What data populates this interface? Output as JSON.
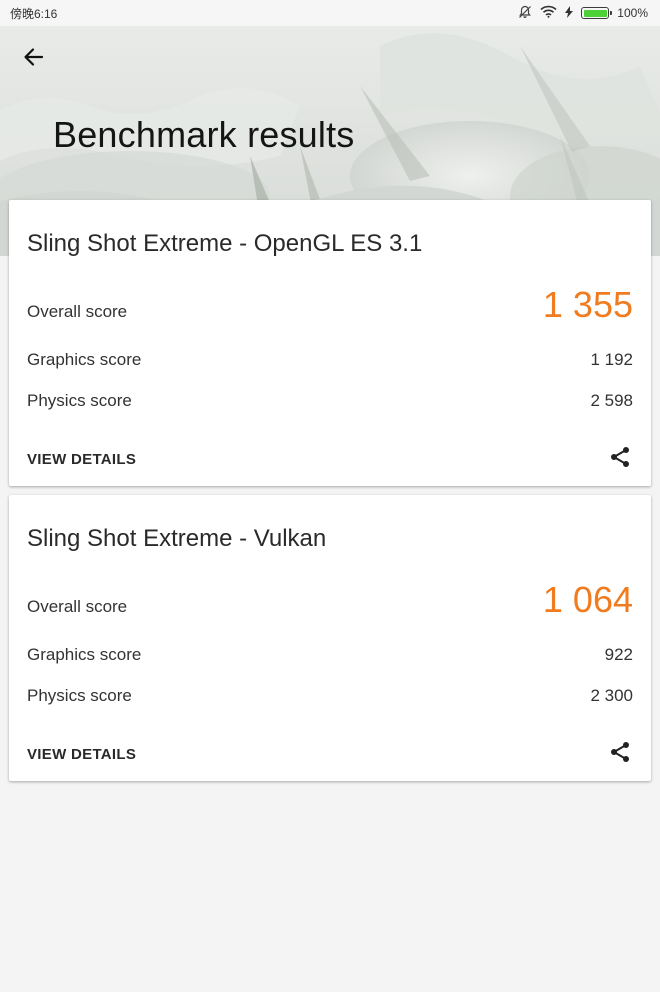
{
  "status_bar": {
    "time": "傍晚6:16",
    "battery": "100%",
    "icons": [
      "notifications-off-icon",
      "wifi-icon",
      "charging-icon",
      "battery-icon"
    ]
  },
  "header": {
    "back_icon": "arrow-back-icon",
    "title": "Benchmark results"
  },
  "results": [
    {
      "title": "Sling Shot Extreme - OpenGL ES 3.1",
      "overall_label": "Overall score",
      "overall_value": "1 355",
      "graphics_label": "Graphics score",
      "graphics_value": "1 192",
      "physics_label": "Physics score",
      "physics_value": "2 598",
      "details_label": "VIEW DETAILS",
      "share_icon": "share-icon"
    },
    {
      "title": "Sling Shot Extreme - Vulkan",
      "overall_label": "Overall score",
      "overall_value": "1 064",
      "graphics_label": "Graphics score",
      "graphics_value": "922",
      "physics_label": "Physics score",
      "physics_value": "2 300",
      "details_label": "VIEW DETAILS",
      "share_icon": "share-icon"
    }
  ],
  "colors": {
    "accent": "#f07c1f",
    "background": "#f4f4f4",
    "card": "#ffffff"
  }
}
